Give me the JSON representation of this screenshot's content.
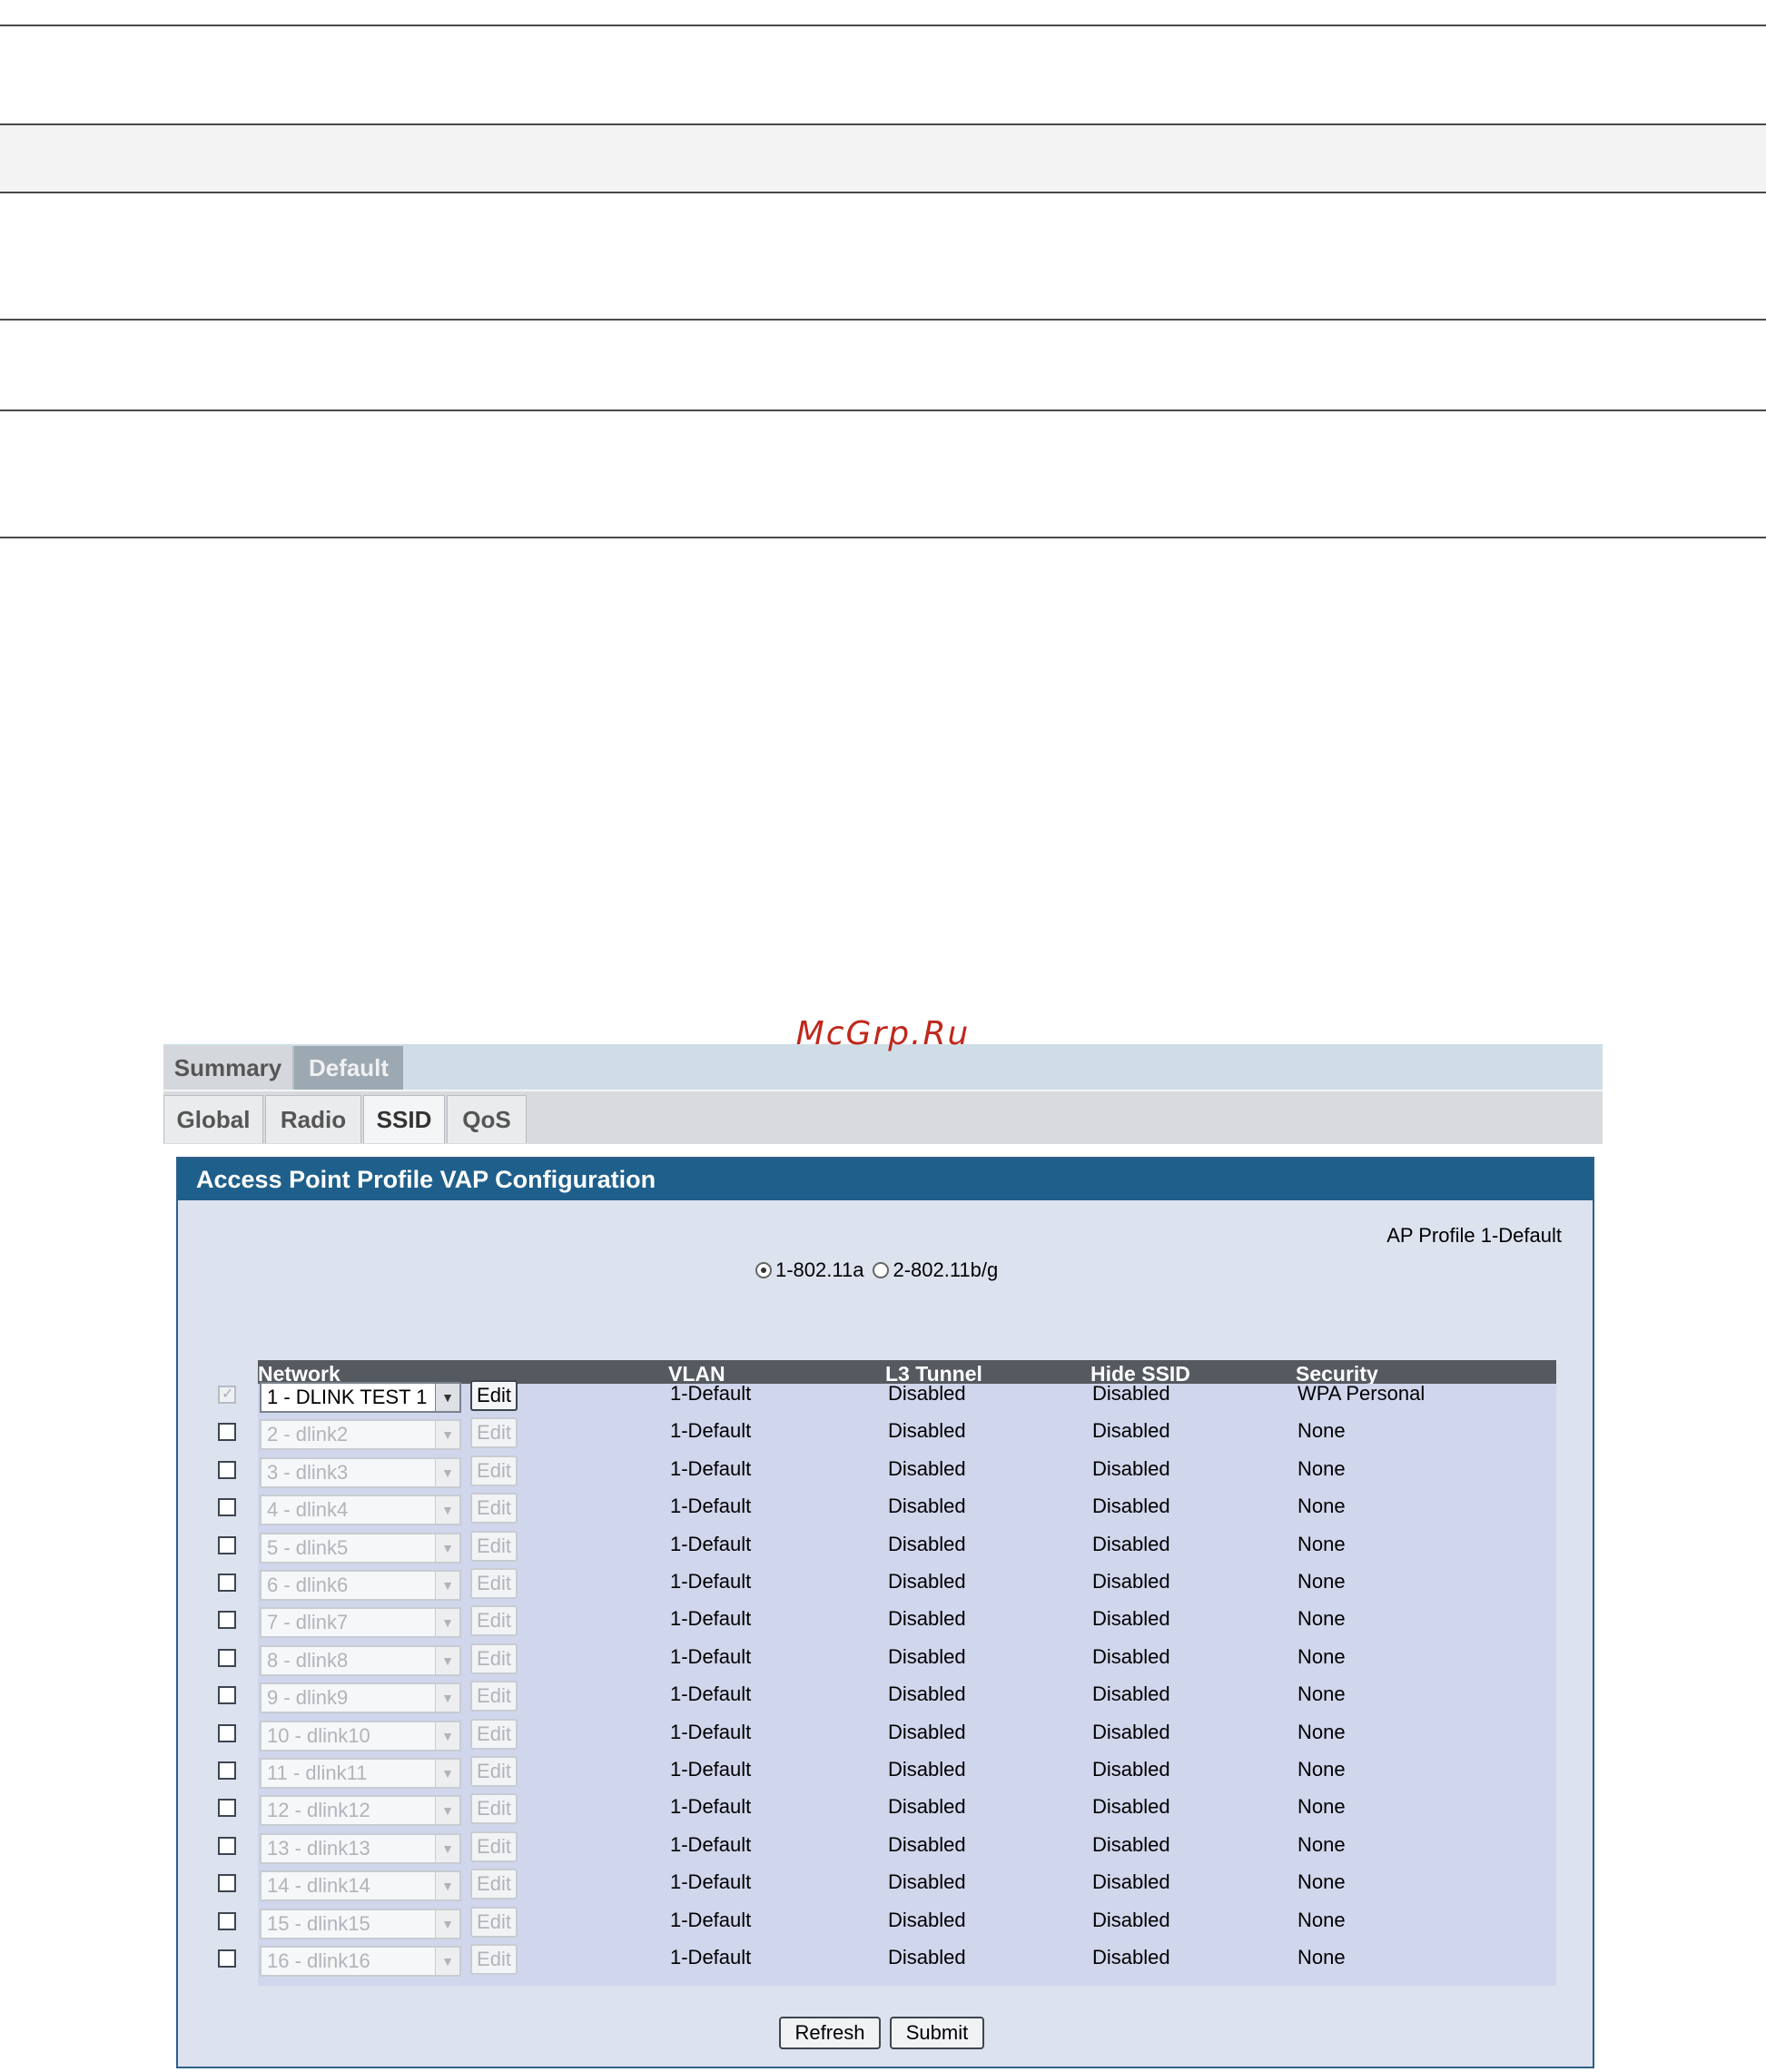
{
  "watermark": "McGrp.Ru",
  "tabs_top": [
    {
      "label": "Summary",
      "active": false
    },
    {
      "label": "Default",
      "active": true
    }
  ],
  "tabs_sub": [
    {
      "label": "Global",
      "selected": false
    },
    {
      "label": "Radio",
      "selected": false
    },
    {
      "label": "SSID",
      "selected": true
    },
    {
      "label": "QoS",
      "selected": false
    }
  ],
  "config": {
    "title": "Access Point Profile VAP Configuration",
    "ap_profile": "AP Profile 1-Default",
    "radio_options": [
      {
        "label": "1-802.11a",
        "selected": true
      },
      {
        "label": "2-802.11b/g",
        "selected": false
      }
    ],
    "columns": [
      "Network",
      "VLAN",
      "L3 Tunnel",
      "Hide SSID",
      "Security"
    ],
    "edit_label": "Edit",
    "rows": [
      {
        "network": "1 - DLINK TEST 1",
        "vlan": "1-Default",
        "l3": "Disabled",
        "hide": "Disabled",
        "security": "WPA Personal",
        "enabled": true,
        "checked": true
      },
      {
        "network": "2 - dlink2",
        "vlan": "1-Default",
        "l3": "Disabled",
        "hide": "Disabled",
        "security": "None",
        "enabled": false,
        "checked": false
      },
      {
        "network": "3 - dlink3",
        "vlan": "1-Default",
        "l3": "Disabled",
        "hide": "Disabled",
        "security": "None",
        "enabled": false,
        "checked": false
      },
      {
        "network": "4 - dlink4",
        "vlan": "1-Default",
        "l3": "Disabled",
        "hide": "Disabled",
        "security": "None",
        "enabled": false,
        "checked": false
      },
      {
        "network": "5 - dlink5",
        "vlan": "1-Default",
        "l3": "Disabled",
        "hide": "Disabled",
        "security": "None",
        "enabled": false,
        "checked": false
      },
      {
        "network": "6 - dlink6",
        "vlan": "1-Default",
        "l3": "Disabled",
        "hide": "Disabled",
        "security": "None",
        "enabled": false,
        "checked": false
      },
      {
        "network": "7 - dlink7",
        "vlan": "1-Default",
        "l3": "Disabled",
        "hide": "Disabled",
        "security": "None",
        "enabled": false,
        "checked": false
      },
      {
        "network": "8 - dlink8",
        "vlan": "1-Default",
        "l3": "Disabled",
        "hide": "Disabled",
        "security": "None",
        "enabled": false,
        "checked": false
      },
      {
        "network": "9 - dlink9",
        "vlan": "1-Default",
        "l3": "Disabled",
        "hide": "Disabled",
        "security": "None",
        "enabled": false,
        "checked": false
      },
      {
        "network": "10 - dlink10",
        "vlan": "1-Default",
        "l3": "Disabled",
        "hide": "Disabled",
        "security": "None",
        "enabled": false,
        "checked": false
      },
      {
        "network": "11 - dlink11",
        "vlan": "1-Default",
        "l3": "Disabled",
        "hide": "Disabled",
        "security": "None",
        "enabled": false,
        "checked": false
      },
      {
        "network": "12 - dlink12",
        "vlan": "1-Default",
        "l3": "Disabled",
        "hide": "Disabled",
        "security": "None",
        "enabled": false,
        "checked": false
      },
      {
        "network": "13 - dlink13",
        "vlan": "1-Default",
        "l3": "Disabled",
        "hide": "Disabled",
        "security": "None",
        "enabled": false,
        "checked": false
      },
      {
        "network": "14 - dlink14",
        "vlan": "1-Default",
        "l3": "Disabled",
        "hide": "Disabled",
        "security": "None",
        "enabled": false,
        "checked": false
      },
      {
        "network": "15 - dlink15",
        "vlan": "1-Default",
        "l3": "Disabled",
        "hide": "Disabled",
        "security": "None",
        "enabled": false,
        "checked": false
      },
      {
        "network": "16 - dlink16",
        "vlan": "1-Default",
        "l3": "Disabled",
        "hide": "Disabled",
        "security": "None",
        "enabled": false,
        "checked": false
      }
    ],
    "buttons": {
      "refresh": "Refresh",
      "submit": "Submit"
    }
  },
  "icons": {
    "dropdown": "chevron-down-icon",
    "checkmark": "checkmark-icon",
    "radio": "radio-icon"
  },
  "colors": {
    "title_bar": "#1f5f8b",
    "header_row": "#555a60",
    "table_bg": "#d0d6ec",
    "watermark": "#c0281c"
  }
}
